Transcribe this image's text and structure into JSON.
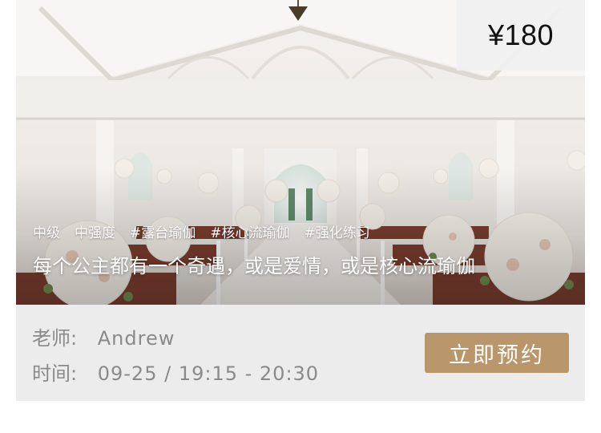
{
  "course": {
    "price": "¥180",
    "tags": [
      "中级",
      "中强度",
      "#露台瑜伽",
      "#核心流瑜伽",
      "#强化练习"
    ],
    "headline": "每个公主都有一个奇遇，或是爱情，或是核心流瑜伽",
    "teacher_label": "老师:",
    "teacher_name": "Andrew",
    "time_label": "时间:",
    "time_value": "09-25 / 19:15 - 20:30",
    "book_label": "立即预约"
  },
  "colors": {
    "button": "#b9976a",
    "card_bg": "#ececec",
    "info_text": "#8a8a8a"
  }
}
